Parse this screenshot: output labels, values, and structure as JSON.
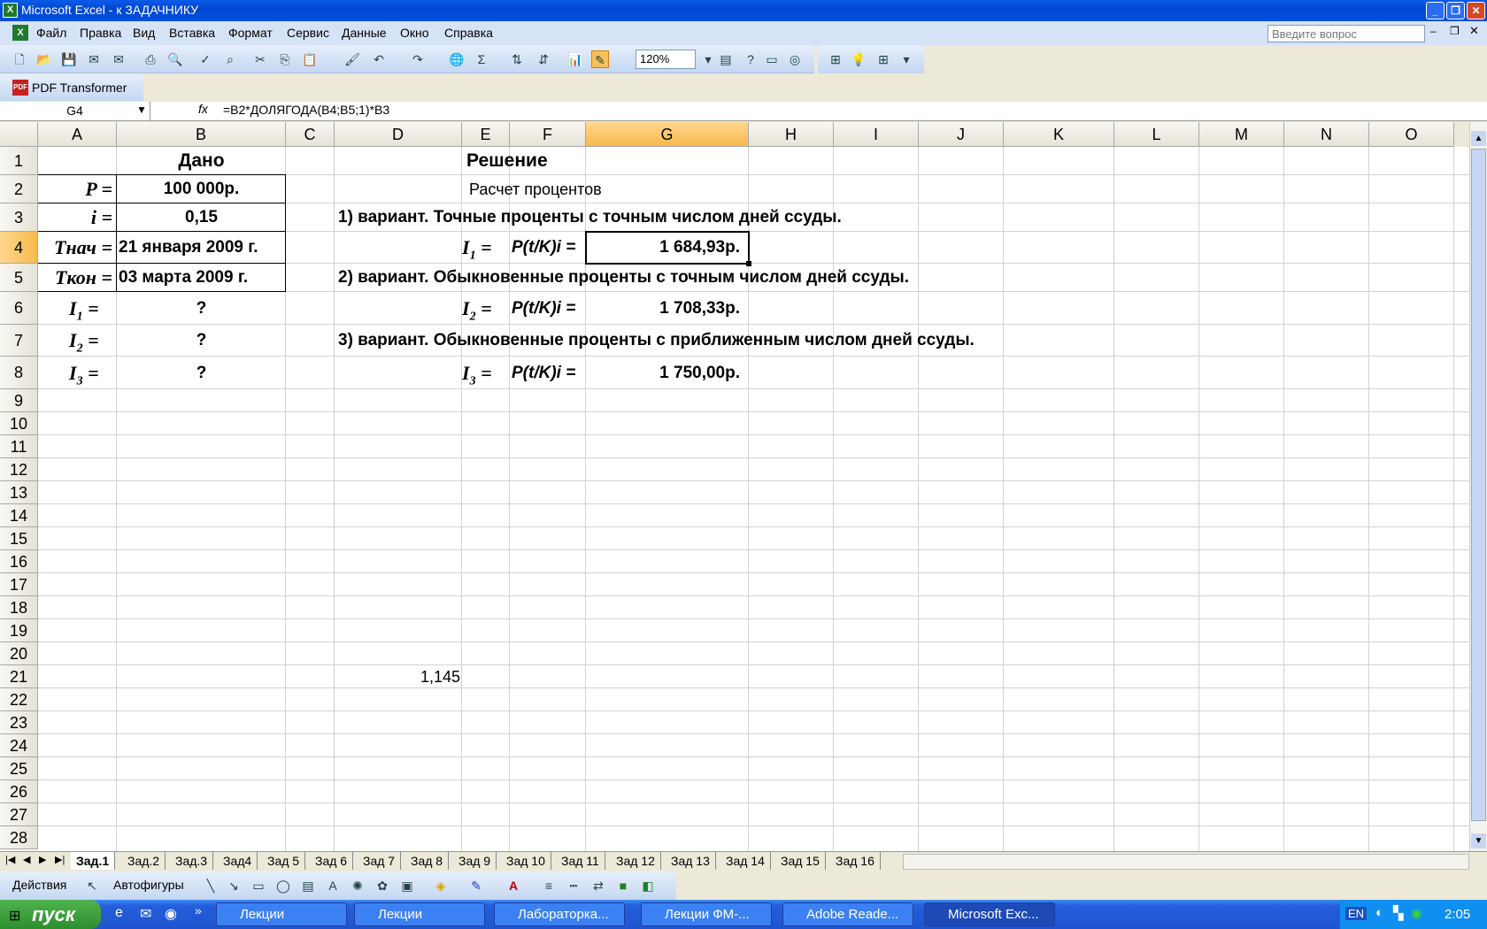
{
  "window": {
    "title": "Microsoft Excel - к ЗАДАЧНИКУ"
  },
  "menu": [
    "Файл",
    "Правка",
    "Вид",
    "Вставка",
    "Формат",
    "Сервис",
    "Данные",
    "Окно",
    "Справка"
  ],
  "help_box": {
    "placeholder": "Введите вопрос"
  },
  "toolbar": {
    "zoom": "120%",
    "pdf_transformer": "PDF Transformer"
  },
  "formula_bar": {
    "name_box": "G4",
    "fx": "fx",
    "formula": "=B2*ДОЛЯГОДА(B4;B5;1)*B3"
  },
  "columns": [
    "A",
    "B",
    "C",
    "D",
    "E",
    "F",
    "G",
    "H",
    "I",
    "J",
    "K",
    "L",
    "M",
    "N",
    "O"
  ],
  "rows": [
    "1",
    "2",
    "3",
    "4",
    "5",
    "6",
    "7",
    "8",
    "9",
    "10",
    "11",
    "12",
    "13",
    "14",
    "15",
    "16",
    "17",
    "18",
    "19",
    "20",
    "21",
    "22",
    "23",
    "24",
    "25",
    "26",
    "27",
    "28"
  ],
  "cells": {
    "B1": "Дано",
    "A2": "P =",
    "B2": "100 000р.",
    "A3": "i =",
    "B3": "0,15",
    "A4": "Tнач =",
    "B4": "21 января 2009 г.",
    "A5": "Tкон =",
    "B5": "03 марта 2009 г.",
    "A6": "I",
    "A6_sub": "1",
    "A6_eq": "=",
    "B6": "?",
    "A7": "I",
    "A7_sub": "2",
    "A7_eq": "=",
    "B7": "?",
    "A8": "I",
    "A8_sub": "3",
    "A8_eq": "=",
    "B8": "?",
    "E1": "Решение",
    "E2": "Расчет процентов",
    "D3": "1) вариант. Точные проценты с точным числом дней ссуды.",
    "E4": "I",
    "E4_sub": "1",
    "E4_eq": "=",
    "F4": "P(t/K)i =",
    "G4": "1 684,93р.",
    "D5": "2) вариант. Обыкновенные проценты с точным числом дней ссуды.",
    "E6": "I",
    "E6_sub": "2",
    "E6_eq": "=",
    "F6": "P(t/K)i =",
    "G6": "1 708,33р.",
    "D7": "3) вариант. Обыкновенные проценты с приближенным числом дней ссуды.",
    "E8": "I",
    "E8_sub": "3",
    "E8_eq": "=",
    "F8": "P(t/K)i =",
    "G8": "1 750,00р.",
    "D21": "1,145"
  },
  "sheet_tabs": [
    "Зад.1",
    "Зад.2",
    "Зад.3",
    "Зад4",
    "Зад 5",
    "Зад 6",
    "Зад 7",
    "Зад 8",
    "Зад 9",
    "Зад 10",
    "Зад 11",
    "Зад 12",
    "Зад 13",
    "Зад 14",
    "Зад 15",
    "Зад 16"
  ],
  "draw_toolbar": {
    "actions": "Действия",
    "autoshapes": "Автофигуры"
  },
  "taskbar": {
    "start": "пуск",
    "tasks": [
      "Лекции",
      "Лекции",
      "Лабораторка...",
      "Лекции ФМ-...",
      "Adobe Reade...",
      "Microsoft Exc..."
    ],
    "lang": "EN",
    "clock": "2:05"
  }
}
